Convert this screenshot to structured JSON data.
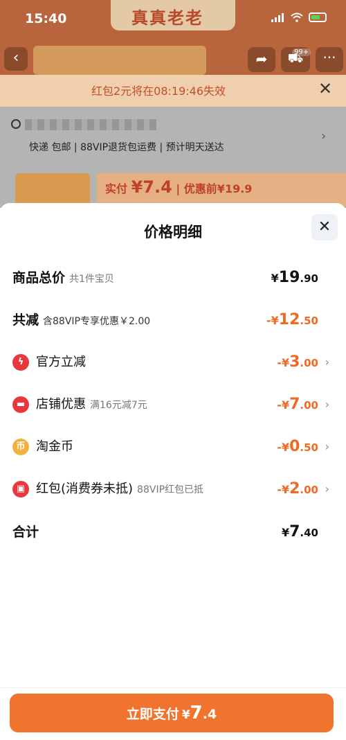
{
  "status_bar": {
    "time": "15:40"
  },
  "background": {
    "brand_banner": "真真老老",
    "cart_badge": "99+",
    "notice": "红包2元将在08:19:46失效",
    "shipping": "快递 包邮 | 88VIP退货包运费 | 预计明天送达",
    "price_label": "实付",
    "price_value": "¥7.4",
    "price_before": "| 优惠前¥19.9"
  },
  "sheet": {
    "title": "价格明细",
    "rows": [
      {
        "label": "商品总价",
        "sub": "共1件宝贝",
        "currency": "¥",
        "int": "19",
        "dec": ".90",
        "color": "#111111"
      },
      {
        "label": "共减",
        "sub": "含88VIP专享优惠￥2.00",
        "currency": "-¥",
        "int": "12",
        "dec": ".50",
        "color": "#f06a24"
      },
      {
        "label": "官方立减",
        "sub": "",
        "currency": "-¥",
        "int": "3",
        "dec": ".00",
        "icon": "lightning-icon",
        "icon_color": "#e8383d"
      },
      {
        "label": "店铺优惠",
        "sub": "满16元减7元",
        "currency": "-¥",
        "int": "7",
        "dec": ".00",
        "icon": "shop-coupon-icon",
        "icon_color": "#e8383d"
      },
      {
        "label": "淘金币",
        "sub": "",
        "currency": "-¥",
        "int": "0",
        "dec": ".50",
        "icon": "gold-coin-icon",
        "icon_color": "#f2b13c"
      },
      {
        "label": "红包(消费券未抵)",
        "sub": "88VIP红包已抵",
        "currency": "-¥",
        "int": "2",
        "dec": ".00",
        "icon": "red-packet-icon",
        "icon_color": "#e8383d"
      },
      {
        "label": "合计",
        "sub": "",
        "currency": "¥",
        "int": "7",
        "dec": ".40",
        "color": "#111111"
      }
    ]
  },
  "pay_button": {
    "label": "立即支付",
    "currency": "¥",
    "int": "7",
    "dec": ".4",
    "color": "#f0742e"
  }
}
